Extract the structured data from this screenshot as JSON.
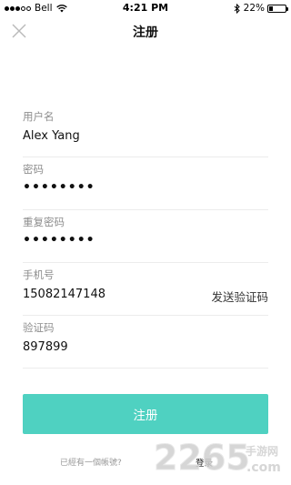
{
  "status_bar": {
    "carrier": "Bell",
    "time": "4:21 PM",
    "battery_percent": "22%",
    "battery_level": 0.22,
    "icons": [
      "signal-dots-icon",
      "wifi-icon",
      "bluetooth-icon",
      "battery-icon"
    ]
  },
  "nav": {
    "title": "注册",
    "close_icon": "close-icon"
  },
  "form": {
    "username": {
      "label": "用户名",
      "value": "Alex Yang"
    },
    "password": {
      "label": "密码",
      "value": "••••••••"
    },
    "confirm_password": {
      "label": "重复密码",
      "value": "••••••••"
    },
    "phone": {
      "label": "手机号",
      "value": "15082147148",
      "send_code_label": "发送验证码"
    },
    "code": {
      "label": "验证码",
      "value": "897899"
    }
  },
  "submit": {
    "label": "注册"
  },
  "footer": {
    "prompt": "已經有一個帳號?",
    "login_link": "登录"
  },
  "watermark": {
    "brand": "2265",
    "sub": "手游网",
    "domain": ".com"
  },
  "colors": {
    "accent": "#4fd1c1",
    "label_gray": "#8e8e8e",
    "divider": "#ececec"
  }
}
